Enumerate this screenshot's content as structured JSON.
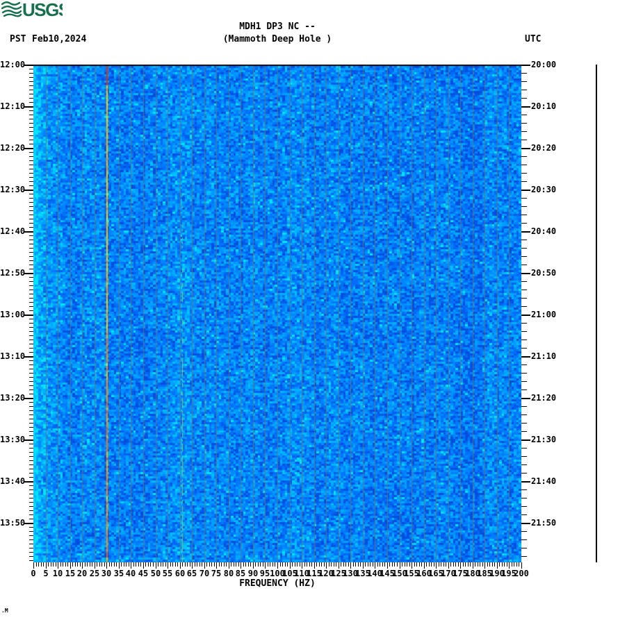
{
  "header": {
    "logo_text": "USGS",
    "timezone_left": "PST",
    "date": "Feb10,2024",
    "title_line1": "MDH1 DP3 NC --",
    "title_line2": "(Mammoth Deep Hole )",
    "timezone_right": "UTC"
  },
  "footnote": ".M",
  "colors": {
    "background": "#ffffff",
    "usgs_green": "#15704c",
    "axis_text": "#000000",
    "spectrogram_base_blue": "#0086ff",
    "gridline": "#74746a",
    "anomaly_30hz_top": "#e03008",
    "anomaly_30hz": "#ffb400",
    "powerline_green": "#7ecc3c",
    "trace_line": "#000000"
  },
  "chart_data": {
    "type": "heatmap",
    "title": "MDH1 DP3 NC --",
    "subtitle": "(Mammoth Deep Hole )",
    "station": {
      "station_code": "MDH1",
      "channel": "DP3",
      "network_code": "NC",
      "location_code": "--",
      "site_name": "Mammoth Deep Hole"
    },
    "date": "Feb10,2024",
    "xlabel": "FREQUENCY (HZ)",
    "x_range_hz": [
      0,
      200
    ],
    "x_major_tick_step_hz": 5,
    "x_minor_tick_step_hz": 1,
    "x_tick_labels": [
      "0",
      "5",
      "10",
      "15",
      "20",
      "25",
      "30",
      "35",
      "40",
      "45",
      "50",
      "55",
      "60",
      "65",
      "70",
      "75",
      "80",
      "85",
      "90",
      "95",
      "100",
      "105",
      "110",
      "115",
      "120",
      "125",
      "130",
      "135",
      "140",
      "145",
      "150",
      "155",
      "160",
      "165",
      "170",
      "175",
      "180",
      "185",
      "190",
      "195",
      "200"
    ],
    "y_axis_left": {
      "timezone": "PST",
      "span_minutes": 120,
      "major_tick_interval_min": 10,
      "minor_tick_interval_min": 1,
      "tick_labels": [
        "12:00",
        "12:10",
        "12:20",
        "12:30",
        "12:40",
        "12:50",
        "13:00",
        "13:10",
        "13:20",
        "13:30",
        "13:40",
        "13:50"
      ]
    },
    "y_axis_right": {
      "timezone": "UTC",
      "span_minutes": 120,
      "major_tick_interval_min": 10,
      "minor_tick_interval_min": 2,
      "tick_labels": [
        "20:00",
        "20:10",
        "20:20",
        "20:30",
        "20:40",
        "20:50",
        "21:00",
        "21:10",
        "21:20",
        "21:30",
        "21:40",
        "21:50"
      ]
    },
    "gridlines_every_hz": 5,
    "grid_on": true,
    "legend": null,
    "palette_blues": [
      "#0050e0",
      "#0060ee",
      "#006ef6",
      "#007afc",
      "#0086ff",
      "#0092ff",
      "#00a0ff",
      "#00b0ff",
      "#00c0ff",
      "#00d2ff",
      "#00e4ff"
    ],
    "background_description": "uniform broadband blue noise over full 12:00-14:00 PST window",
    "features": [
      {
        "name": "tonal-line-30hz",
        "frequency_hz": 30,
        "colors": [
          "#e03008",
          "#ffc400",
          "#ff8c00"
        ],
        "time_extent": "full height 12:00-14:00, red at very top then yellow-orange"
      },
      {
        "name": "tonal-line-61hz",
        "frequency_hz": 61,
        "color": "#7ecc3c",
        "time_extent": "approx 12:30-14:00 only, faint green"
      },
      {
        "name": "low-frequency-energy",
        "frequency_hz": [
          0,
          8
        ],
        "color": "bright cyan",
        "time_extent": "full height, brightest at 0-2 Hz edge"
      },
      {
        "name": "dark-top-row",
        "description": "thin dark row at 12:00 top edge"
      }
    ],
    "right_margin_trace": "flat vertical black amplitude trace line (no events)"
  }
}
